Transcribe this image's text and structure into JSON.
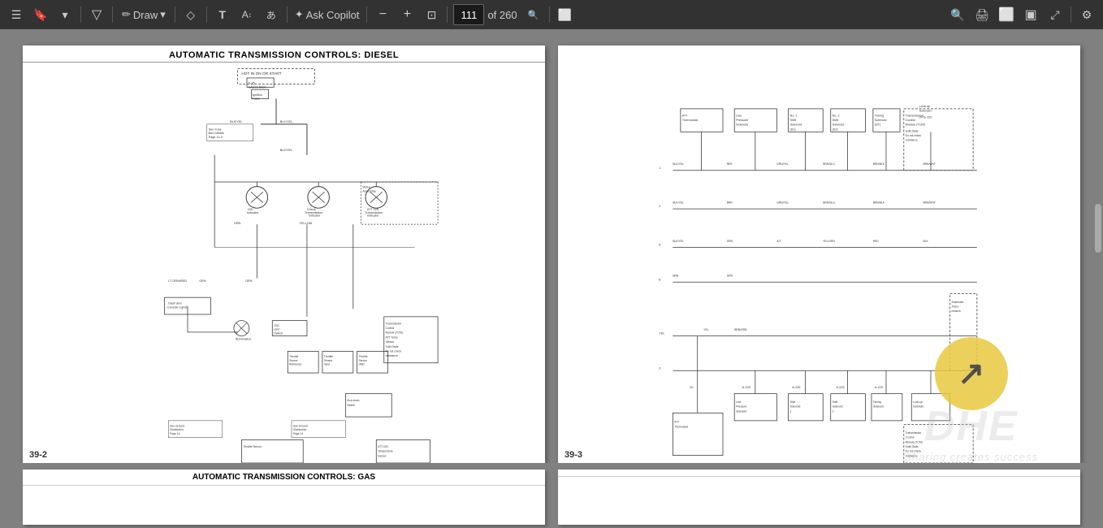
{
  "toolbar": {
    "page_input_value": "111",
    "of_label": "of 260",
    "draw_label": "Draw",
    "ask_copilot_label": "Ask Copilot",
    "buttons": [
      {
        "name": "hamburger-icon",
        "icon": "☰"
      },
      {
        "name": "bookmark-icon",
        "icon": "🔖"
      },
      {
        "name": "chevron-down-icon",
        "icon": "▾"
      },
      {
        "name": "filter-icon",
        "icon": "▽"
      },
      {
        "name": "draw-label",
        "text": "Draw"
      },
      {
        "name": "draw-chevron",
        "icon": "▾"
      },
      {
        "name": "diamond-icon",
        "icon": "◇"
      },
      {
        "name": "text-icon",
        "icon": "T"
      },
      {
        "name": "font-icon",
        "icon": "A"
      },
      {
        "name": "az-icon",
        "icon": "あ"
      },
      {
        "name": "copilot-icon",
        "icon": "✦"
      },
      {
        "name": "minus-icon",
        "icon": "−"
      },
      {
        "name": "plus-icon",
        "icon": "+"
      },
      {
        "name": "fullview-icon",
        "icon": "⊞"
      },
      {
        "name": "search-icon",
        "icon": "🔍"
      },
      {
        "name": "print-icon",
        "icon": "🖨"
      },
      {
        "name": "share-icon",
        "icon": "□"
      },
      {
        "name": "save-icon",
        "icon": "▣"
      },
      {
        "name": "expand-icon",
        "icon": "⤢"
      },
      {
        "name": "settings-icon",
        "icon": "⚙"
      }
    ]
  },
  "pages": [
    {
      "id": "page-39-2",
      "title": "AUTOMATIC TRANSMISSION CONTROLS: DIESEL",
      "page_number": "39-2",
      "side": "left"
    },
    {
      "id": "page-39-3",
      "title": "",
      "page_number": "39-3",
      "side": "right"
    }
  ],
  "bottom_pages": [
    {
      "id": "bottom-left",
      "title": "AUTOMATIC TRANSMISSION CONTROLS: GAS"
    },
    {
      "id": "bottom-right",
      "title": ""
    }
  ],
  "watermark": {
    "circle_color": "#e8c840",
    "arrow": "↗",
    "brand_text": "DHE",
    "tagline": "Sharing creates success"
  }
}
